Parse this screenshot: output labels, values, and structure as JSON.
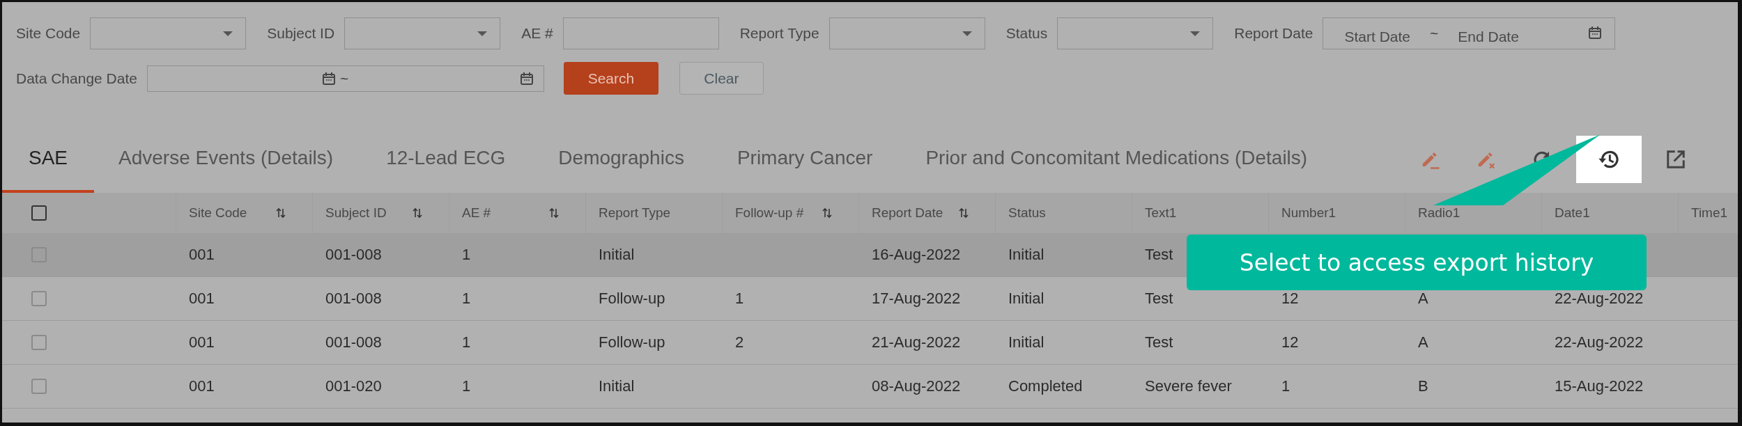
{
  "filters": [
    [
      {
        "kind": "select",
        "label": "Site Code"
      },
      {
        "kind": "select",
        "label": "Subject ID"
      },
      {
        "kind": "input",
        "label": "AE #"
      },
      {
        "kind": "select",
        "label": "Report Type"
      },
      {
        "kind": "select",
        "label": "Status"
      },
      {
        "kind": "daterange",
        "label": "Report Date",
        "start_placeholder": "Start Date",
        "separator": "~",
        "end_placeholder": "End Date"
      }
    ],
    [
      {
        "kind": "daterange2",
        "label": "Data Change Date",
        "separator": "~"
      },
      {
        "kind": "button",
        "label": "Search",
        "primary": true
      },
      {
        "kind": "button",
        "label": "Clear",
        "primary": false
      }
    ]
  ],
  "tabs": [
    {
      "label": "SAE",
      "selected": true
    },
    {
      "label": "Adverse Events (Details)",
      "selected": false
    },
    {
      "label": "12-Lead ECG",
      "selected": false
    },
    {
      "label": "Demographics",
      "selected": false
    },
    {
      "label": "Primary Cancer",
      "selected": false
    },
    {
      "label": "Prior and Concomitant Medications (Details)",
      "selected": false
    }
  ],
  "toolbar": [
    {
      "kind": "edit",
      "highlighted": false
    },
    {
      "kind": "edit-delete",
      "highlighted": false
    },
    {
      "kind": "refresh",
      "highlighted": false
    },
    {
      "kind": "history",
      "highlighted": true
    },
    {
      "kind": "export",
      "highlighted": false
    }
  ],
  "table": {
    "header_checked": false,
    "columns": [
      {
        "label": "Site Code",
        "sortable": true
      },
      {
        "label": "Subject ID",
        "sortable": true
      },
      {
        "label": "AE #",
        "sortable": true
      },
      {
        "label": "Report Type"
      },
      {
        "label": "Follow-up #",
        "sortable": true
      },
      {
        "label": "Report Date",
        "sortable": true
      },
      {
        "label": "Status"
      },
      {
        "label": "Text1"
      },
      {
        "label": "Number1"
      },
      {
        "label": "Radio1"
      },
      {
        "label": "Date1"
      },
      {
        "label": "Time1"
      }
    ],
    "rows": [
      {
        "checked": false,
        "hovered": true,
        "cells": [
          "001",
          "001-008",
          "1",
          "Initial",
          null,
          "16-Aug-2022",
          "Initial",
          "Test",
          null,
          null,
          null,
          null
        ]
      },
      {
        "checked": false,
        "hovered": false,
        "cells": [
          "001",
          "001-008",
          "1",
          "Follow-up",
          "1",
          "17-Aug-2022",
          "Initial",
          "Test",
          "12",
          "A",
          "22-Aug-2022",
          null
        ]
      },
      {
        "checked": false,
        "hovered": false,
        "cells": [
          "001",
          "001-008",
          "1",
          "Follow-up",
          "2",
          "21-Aug-2022",
          "Initial",
          "Test",
          "12",
          "A",
          "22-Aug-2022",
          null
        ]
      },
      {
        "checked": false,
        "hovered": false,
        "cells": [
          "001",
          "001-020",
          "1",
          "Initial",
          null,
          "08-Aug-2022",
          "Completed",
          "Severe fever",
          "1",
          "B",
          "15-Aug-2022",
          null
        ]
      }
    ]
  },
  "tooltip": {
    "text": "Select to access export history"
  }
}
